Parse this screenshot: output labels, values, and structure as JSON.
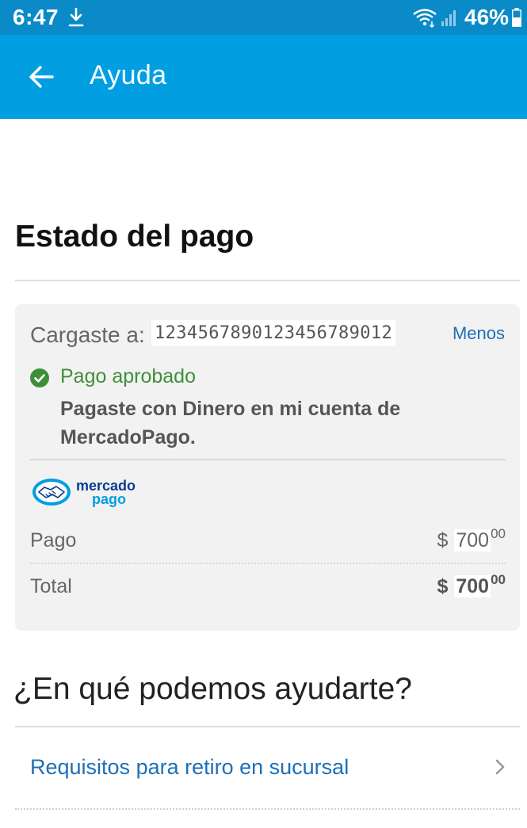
{
  "status_bar": {
    "time": "6:47",
    "battery": "46%",
    "icons": [
      "download-icon",
      "wifi-icon",
      "signal-icon",
      "battery-icon"
    ]
  },
  "app_bar": {
    "title": "Ayuda",
    "back_icon": "arrow-left-icon"
  },
  "payment": {
    "section_title": "Estado del pago",
    "cargaste_label": "Cargaste a:",
    "cargaste_value": "1234567890123456789012",
    "toggle_label": "Menos",
    "status_label": "Pago aprobado",
    "status_description": "Pagaste con Dinero en mi cuenta de MercadoPago.",
    "logo": {
      "line1": "mercado",
      "line2": "pago"
    },
    "rows": [
      {
        "label": "Pago",
        "currency": "$",
        "amount": "700",
        "cents": "00"
      },
      {
        "label": "Total",
        "currency": "$",
        "amount": "700",
        "cents": "00"
      }
    ]
  },
  "help": {
    "title": "¿En qué podemos ayudarte?",
    "items": [
      {
        "label": "Requisitos para retiro en sucursal"
      }
    ]
  },
  "colors": {
    "status_bar": "#0a8bc7",
    "app_bar": "#019fe2",
    "link": "#1e6fb8",
    "approved": "#3f8f3a",
    "card_bg": "#f2f2f2"
  }
}
